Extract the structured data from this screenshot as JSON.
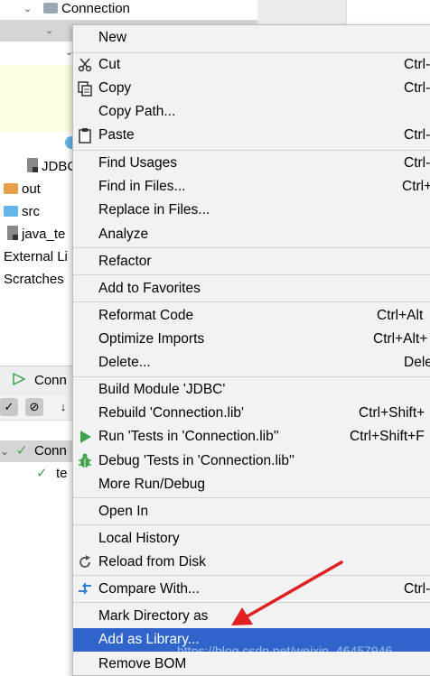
{
  "tree": {
    "connection_label": "Connection",
    "jdbc_label": "JDBC",
    "out_label": "out",
    "src_label": "src",
    "java_te_label": "java_te",
    "external_label": "External Li",
    "scratches_label": "Scratches"
  },
  "run_panel": {
    "tab_label": "Conn",
    "row1_label": "Conn",
    "row2_label": "te"
  },
  "menu": {
    "new": "New",
    "cut": "Cut",
    "cut_sc": "Ctrl-",
    "copy": "Copy",
    "copy_sc": "Ctrl-",
    "copy_path": "Copy Path...",
    "paste": "Paste",
    "paste_sc": "Ctrl-",
    "find_usages": "Find Usages",
    "find_usages_sc": "Ctrl-",
    "find_in_files": "Find in Files...",
    "find_in_files_sc": "Ctrl+",
    "replace_in_files": "Replace in Files...",
    "analyze": "Analyze",
    "refactor": "Refactor",
    "add_favorites": "Add to Favorites",
    "reformat": "Reformat Code",
    "reformat_sc": "Ctrl+Alt",
    "optimize": "Optimize Imports",
    "optimize_sc": "Ctrl+Alt+",
    "delete": "Delete...",
    "delete_sc": "Dele",
    "build_module": "Build Module 'JDBC'",
    "rebuild": "Rebuild 'Connection.lib'",
    "rebuild_sc": "Ctrl+Shift+",
    "run_tests": "Run 'Tests in 'Connection.lib''",
    "run_tests_sc": "Ctrl+Shift+F",
    "debug_tests": "Debug 'Tests in 'Connection.lib''",
    "more_run": "More Run/Debug",
    "open_in": "Open In",
    "local_history": "Local History",
    "reload_disk": "Reload from Disk",
    "compare_with": "Compare With...",
    "compare_with_sc": "Ctrl-",
    "mark_directory": "Mark Directory as",
    "add_library": "Add as Library...",
    "remove_bom": "Remove BOM"
  },
  "watermark": "https://blog.csdn.net/weixin_46457946",
  "colors": {
    "menu_bg": "#f2f2f2",
    "highlight": "#2f65ca",
    "selection_gray": "#d5d5d5",
    "arrow_red": "#e02020",
    "run_green": "#3fa34d"
  },
  "icons": {
    "cut": "scissors-icon",
    "copy": "copy-icon",
    "paste": "clipboard-icon",
    "run": "play-icon",
    "debug": "bug-icon",
    "reload": "refresh-icon",
    "compare": "compare-arrows-icon"
  }
}
